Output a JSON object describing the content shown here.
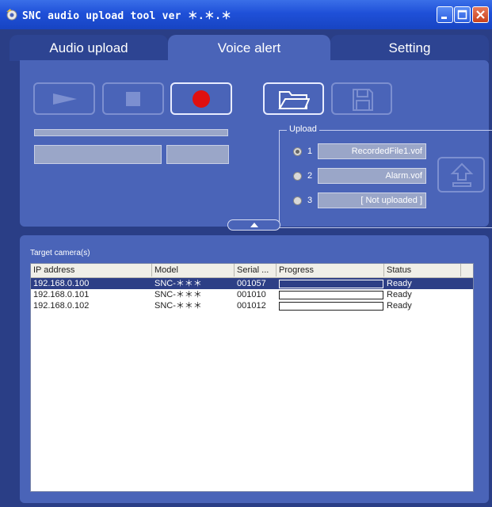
{
  "window": {
    "title": "SNC audio upload tool ver ＊.＊.＊",
    "controls": [
      "minimize-icon",
      "maximize-icon",
      "close-icon"
    ]
  },
  "tabs": [
    {
      "label": "Audio upload",
      "active": false
    },
    {
      "label": "Voice alert",
      "active": true
    },
    {
      "label": "Setting",
      "active": false
    }
  ],
  "playback": {
    "buttons": [
      "play-icon",
      "stop-icon",
      "record-icon"
    ],
    "active": "record-icon"
  },
  "file_buttons": [
    "open-folder-icon",
    "save-icon"
  ],
  "upload": {
    "legend": "Upload",
    "selected_slot": 1,
    "slots": [
      {
        "number": "1",
        "name": "RecordedFile1.vof"
      },
      {
        "number": "2",
        "name": "Alarm.vof"
      },
      {
        "number": "3",
        "name": "[ Not uploaded ]"
      }
    ],
    "upload_button_icon": "upload-arrow-icon"
  },
  "collapse_icon": "chevron-up-icon",
  "targets": {
    "label": "Target camera(s)",
    "columns": [
      "IP address",
      "Model",
      "Serial ...",
      "Progress",
      "Status"
    ],
    "rows": [
      {
        "ip": "192.168.0.100",
        "model": "SNC-＊＊＊",
        "serial": "001057",
        "progress": 0,
        "status": "Ready",
        "selected": true
      },
      {
        "ip": "192.168.0.101",
        "model": "SNC-＊＊＊",
        "serial": "001010",
        "progress": 0,
        "status": "Ready",
        "selected": false
      },
      {
        "ip": "192.168.0.102",
        "model": "SNC-＊＊＊",
        "serial": "001012",
        "progress": 0,
        "status": "Ready",
        "selected": false
      }
    ]
  },
  "colors": {
    "title_bar": "#1f50d8",
    "panel": "#4a64b8",
    "selected_row": "#2d3f86",
    "record_red": "#e01010"
  }
}
